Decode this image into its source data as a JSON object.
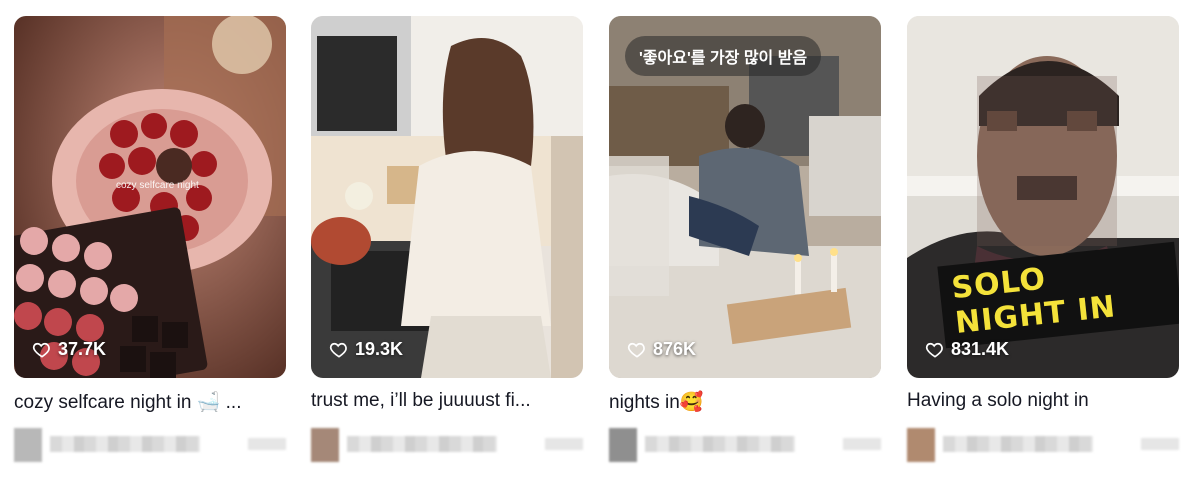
{
  "cards": [
    {
      "likes": "37.7K",
      "caption": "cozy selfcare night in 🛁 ...",
      "overlay": "cozy selfcare night",
      "avatar_color": "#b8b8b8"
    },
    {
      "likes": "19.3K",
      "caption": "trust me, i’ll be juuuust fi...",
      "overlay": "...",
      "avatar_color": "#a58878"
    },
    {
      "likes": "876K",
      "caption": "nights in🥰",
      "badge": "'좋아요'를 가장 많이 받음",
      "avatar_color": "#8f8f8f"
    },
    {
      "likes": "831.4K",
      "caption": "Having a solo night in",
      "sticker": "SOLO NIGHT IN",
      "avatar_color": "#b08a6f"
    }
  ],
  "icons": {
    "like": "heart-outline-icon"
  }
}
